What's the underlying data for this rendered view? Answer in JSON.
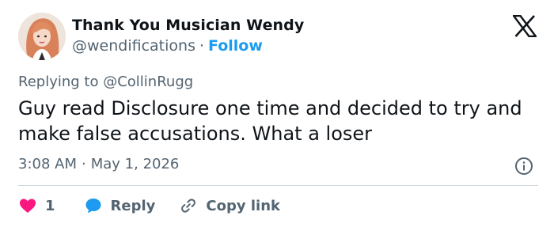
{
  "author": {
    "name": "Thank You Musician Wendy",
    "handle": "@wendifications",
    "separator": "·",
    "follow_label": "Follow"
  },
  "reply_context": {
    "prefix": "Replying to",
    "mention": "@CollinRugg"
  },
  "tweet": {
    "text": "Guy read Disclosure one time and decided to try and make false accusations. What a loser",
    "time": "3:08 AM",
    "separator": "·",
    "date": "May 1, 2026"
  },
  "actions": {
    "like_count": "1",
    "reply_label": "Reply",
    "copy_link_label": "Copy link"
  },
  "icons": {
    "brand": "x-logo-icon",
    "info": "info-icon",
    "like": "heart-icon",
    "reply": "reply-bubble-icon",
    "copy": "link-icon"
  },
  "colors": {
    "text_primary": "#0f1419",
    "text_secondary": "#536471",
    "accent": "#1d9bf0",
    "like": "#f91880",
    "divider": "#cfd9de"
  }
}
